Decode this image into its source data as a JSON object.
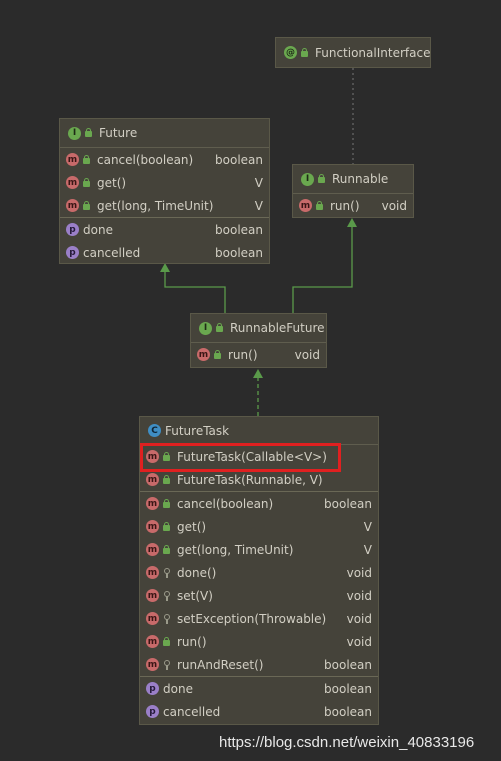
{
  "colors": {
    "background": "#2b2b2b",
    "class_box": "#45433a",
    "edge": "#5a9a4a",
    "highlight": "#e02020"
  },
  "functional_interface": {
    "icon": "@",
    "name": "FunctionalInterface"
  },
  "future": {
    "icon": "I",
    "name": "Future",
    "methods": [
      {
        "icon": "m",
        "name": "cancel(boolean)",
        "type": "boolean"
      },
      {
        "icon": "m",
        "name": "get()",
        "type": "V"
      },
      {
        "icon": "m",
        "name": "get(long, TimeUnit)",
        "type": "V"
      }
    ],
    "properties": [
      {
        "icon": "p",
        "name": "done",
        "type": "boolean"
      },
      {
        "icon": "p",
        "name": "cancelled",
        "type": "boolean"
      }
    ]
  },
  "runnable": {
    "icon": "I",
    "name": "Runnable",
    "methods": [
      {
        "icon": "m",
        "name": "run()",
        "type": "void"
      }
    ]
  },
  "runnable_future": {
    "icon": "I",
    "name": "RunnableFuture",
    "methods": [
      {
        "icon": "m",
        "name": "run()",
        "type": "void"
      }
    ]
  },
  "future_task": {
    "icon": "C",
    "name": "FutureTask",
    "constructors": [
      {
        "icon": "m",
        "name": "FutureTask(Callable<V>)",
        "type": ""
      },
      {
        "icon": "m",
        "name": "FutureTask(Runnable, V)",
        "type": ""
      }
    ],
    "methods": [
      {
        "icon": "m",
        "name": "cancel(boolean)",
        "type": "boolean"
      },
      {
        "icon": "m",
        "name": "get()",
        "type": "V"
      },
      {
        "icon": "m",
        "name": "get(long, TimeUnit)",
        "type": "V"
      },
      {
        "icon": "m",
        "name": "done()",
        "type": "void"
      },
      {
        "icon": "m",
        "name": "set(V)",
        "type": "void"
      },
      {
        "icon": "m",
        "name": "setException(Throwable)",
        "type": "void"
      },
      {
        "icon": "m",
        "name": "run()",
        "type": "void"
      },
      {
        "icon": "m",
        "name": "runAndReset()",
        "type": "boolean"
      }
    ],
    "properties": [
      {
        "icon": "p",
        "name": "done",
        "type": "boolean"
      },
      {
        "icon": "p",
        "name": "cancelled",
        "type": "boolean"
      }
    ]
  },
  "watermark": "https://blog.csdn.net/weixin_40833196"
}
